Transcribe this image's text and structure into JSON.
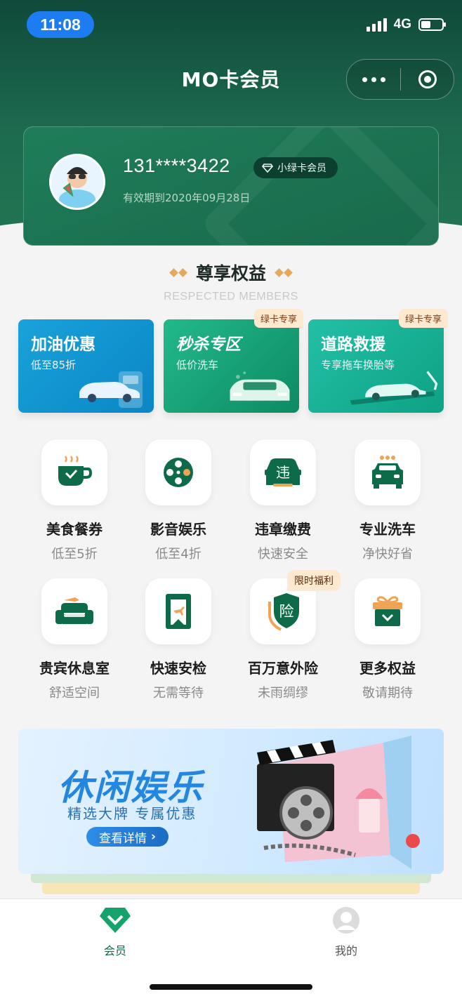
{
  "status_bar": {
    "time": "11:08",
    "network": "4G"
  },
  "nav": {
    "title": "MO卡会员"
  },
  "member": {
    "phone": "131****3422",
    "badge": "小绿卡会员",
    "expiry": "有效期到2020年09月28日"
  },
  "section": {
    "title": "尊享权益",
    "subtitle": "RESPECTED MEMBERS"
  },
  "promos": [
    {
      "title": "加油优惠",
      "sub": "低至85折",
      "tag": ""
    },
    {
      "title": "秒杀专区",
      "sub": "低价洗车",
      "tag": "绿卡专享"
    },
    {
      "title": "道路救援",
      "sub": "专享拖车换胎等",
      "tag": "绿卡专享"
    }
  ],
  "benefits": [
    {
      "name": "美食餐券",
      "desc": "低至5折",
      "icon": "coffee-icon"
    },
    {
      "name": "影音娱乐",
      "desc": "低至4折",
      "icon": "film-reel-icon"
    },
    {
      "name": "违章缴费",
      "desc": "快速安全",
      "icon": "violation-car-icon"
    },
    {
      "name": "专业洗车",
      "desc": "净快好省",
      "icon": "car-wash-icon"
    },
    {
      "name": "贵宾休息室",
      "desc": "舒适空间",
      "icon": "lounge-sofa-icon"
    },
    {
      "name": "快速安检",
      "desc": "无需等待",
      "icon": "security-gate-icon"
    },
    {
      "name": "百万意外险",
      "desc": "未雨绸缪",
      "icon": "insurance-shield-icon",
      "tag": "限时福利"
    },
    {
      "name": "更多权益",
      "desc": "敬请期待",
      "icon": "gift-box-icon"
    }
  ],
  "insurance_icon_char": "险",
  "violation_icon_char": "违",
  "banner": {
    "title": "休闲娱乐",
    "subtitle": "精选大牌  专属优惠",
    "button": "查看详情"
  },
  "tabbar": [
    {
      "label": "会员",
      "active": true
    },
    {
      "label": "我的",
      "active": false
    }
  ],
  "colors": {
    "brand_green": "#1d6a4f",
    "accent_green": "#0e6b4a",
    "tag_bg": "#fde8d0"
  }
}
